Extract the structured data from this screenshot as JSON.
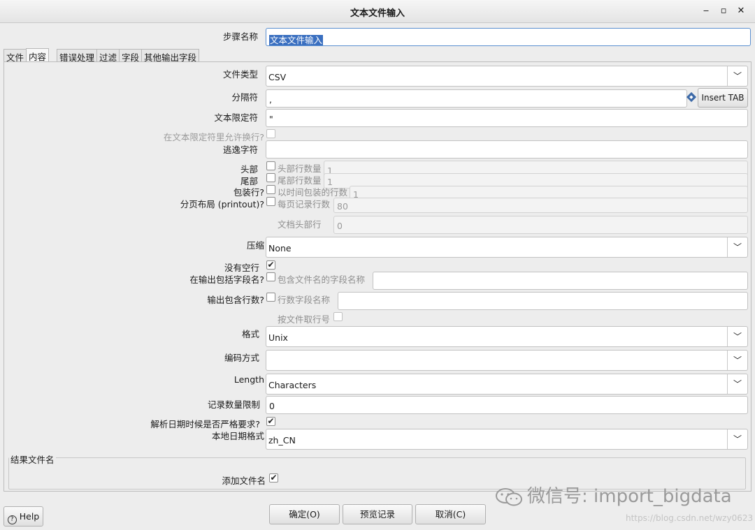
{
  "window": {
    "title": "文本文件输入",
    "minimize": "‒",
    "maximize": "▫",
    "close": "✕"
  },
  "step_name": {
    "label": "步骤名称",
    "value": "文本文件输入"
  },
  "tabs": [
    {
      "label": "文件"
    },
    {
      "label": "内容"
    },
    {
      "label": "错误处理"
    },
    {
      "label": "过滤"
    },
    {
      "label": "字段"
    },
    {
      "label": "其他输出字段"
    }
  ],
  "content": {
    "file_type": {
      "label": "文件类型",
      "value": "CSV"
    },
    "separator": {
      "label": "分隔符",
      "value": ",",
      "insert_tab": "Insert TAB"
    },
    "enclosure": {
      "label": "文本限定符",
      "value": "\""
    },
    "allow_breaks": {
      "label": "在文本限定符里允许换行?"
    },
    "escape": {
      "label": "逃逸字符",
      "value": ""
    },
    "header": {
      "label": "头部",
      "sublabel": "头部行数量",
      "value": "1"
    },
    "footer": {
      "label": "尾部",
      "sublabel": "尾部行数量",
      "value": "1"
    },
    "wrapped": {
      "label": "包装行?",
      "sublabel": "以时间包装的行数",
      "value": "1"
    },
    "paged": {
      "label": "分页布局 (printout)?",
      "sublabel": "每页记录行数",
      "value": "80"
    },
    "doc_header": {
      "sublabel": "文档头部行",
      "value": "0"
    },
    "compression": {
      "label": "压缩",
      "value": "None"
    },
    "no_empty": {
      "label": "没有空行",
      "checked": "✔"
    },
    "include_filename": {
      "label": "在输出包括字段名?",
      "sublabel": "包含文件名的字段名称",
      "value": ""
    },
    "include_rownum": {
      "label": "输出包含行数?",
      "sublabel": "行数字段名称",
      "value": ""
    },
    "rownum_per_file": {
      "sublabel": "按文件取行号"
    },
    "format": {
      "label": "格式",
      "value": "Unix"
    },
    "encoding": {
      "label": "编码方式",
      "value": ""
    },
    "length": {
      "label": "Length",
      "value": "Characters"
    },
    "limit": {
      "label": "记录数量限制",
      "value": "0"
    },
    "lenient_dates": {
      "label": "解析日期时候是否严格要求?",
      "checked": "✔"
    },
    "locale": {
      "label": "本地日期格式",
      "value": "zh_CN"
    }
  },
  "result_filename": {
    "group_label": "结果文件名",
    "add_label": "添加文件名",
    "checked": "✔"
  },
  "buttons": {
    "help": "Help",
    "ok": "确定(O)",
    "preview": "预览记录",
    "cancel": "取消(C)"
  },
  "watermark": {
    "text": "微信号: import_bigdata",
    "url": "https://blog.csdn.net/wzy0623"
  },
  "icons": {
    "dropdown": "chevron-down-icon",
    "help": "help-circle-icon",
    "info": "info-diamond-icon",
    "wechat": "wechat-icon"
  }
}
